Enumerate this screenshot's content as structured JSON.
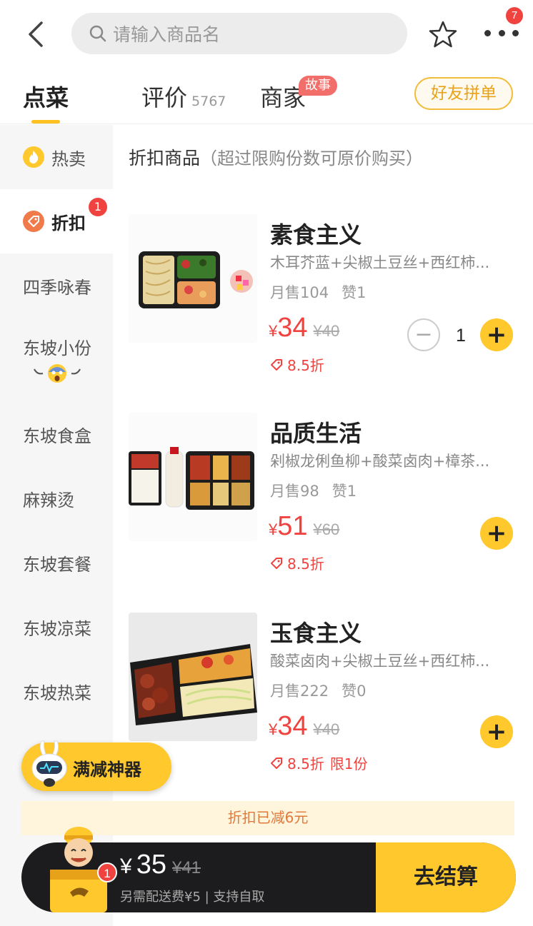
{
  "search": {
    "placeholder": "请输入商品名"
  },
  "header": {
    "more_badge": "7"
  },
  "tabs": [
    {
      "label": "点菜"
    },
    {
      "label": "评价",
      "count": "5767"
    },
    {
      "label": "商家",
      "tag": "故事"
    }
  ],
  "friend_button": "好友拼单",
  "sidebar": {
    "items": [
      {
        "label": "热卖",
        "icon": "fire-icon"
      },
      {
        "label": "折扣",
        "icon": "discount-tag-icon",
        "badge": "1"
      },
      {
        "label": "四季咏春"
      },
      {
        "label": "东坡小份"
      },
      {
        "label": "东坡食盒"
      },
      {
        "label": "麻辣烫"
      },
      {
        "label": "东坡套餐"
      },
      {
        "label": "东坡凉菜"
      },
      {
        "label": "东坡热菜"
      }
    ]
  },
  "section": {
    "title": "折扣商品",
    "note": "（超过限购份数可原价购买）"
  },
  "foods": [
    {
      "name": "素食主义",
      "desc": "木耳芥蓝+尖椒土豆丝+西红柿...",
      "sales": "月售104",
      "likes": "赞1",
      "currency": "¥",
      "price": "34",
      "old_price": "¥40",
      "discount": "8.5折",
      "limit": "",
      "qty": "1"
    },
    {
      "name": "品质生活",
      "desc": "剁椒龙俐鱼柳+酸菜卤肉+樟茶...",
      "sales": "月售98",
      "likes": "赞1",
      "currency": "¥",
      "price": "51",
      "old_price": "¥60",
      "discount": "8.5折",
      "limit": ""
    },
    {
      "name": "玉食主义",
      "desc": "酸菜卤肉+尖椒土豆丝+西红柿...",
      "sales": "月售222",
      "likes": "赞0",
      "currency": "¥",
      "price": "34",
      "old_price": "¥40",
      "discount": "8.5折",
      "limit": "限1份"
    }
  ],
  "promo": {
    "label": "满减神器"
  },
  "discount_bar": "折扣已减6元",
  "cart": {
    "badge": "1",
    "currency": "¥",
    "total": "35",
    "old_total": "¥41",
    "fee": "另需配送费¥5 | 支持自取",
    "checkout": "去结算"
  },
  "colors": {
    "accent": "#ffc82c",
    "price_red": "#f0433f",
    "tag_red": "#f26e6a"
  }
}
